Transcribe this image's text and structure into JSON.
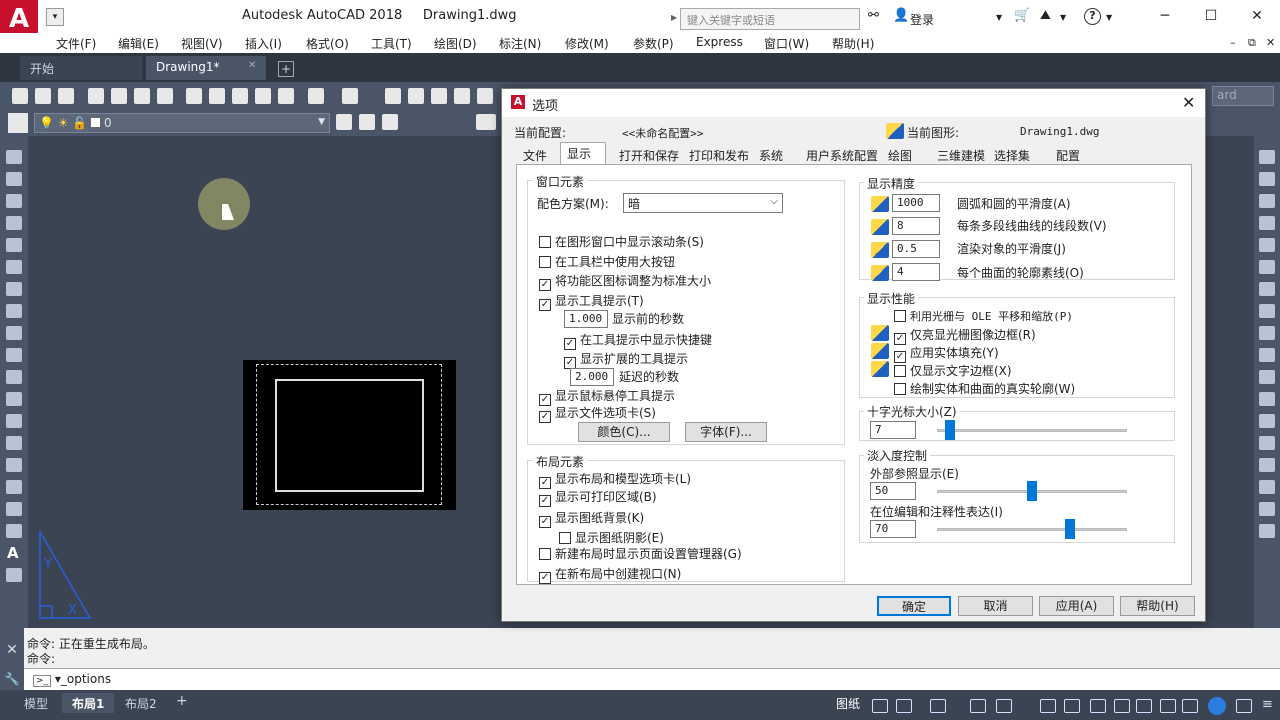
{
  "app": {
    "title": "Autodesk AutoCAD 2018",
    "document": "Drawing1.dwg",
    "logo": "A",
    "search_placeholder": "键入关键字或短语",
    "login": "登录",
    "win_minimize": "─",
    "win_restore": "☐",
    "win_close": "✕"
  },
  "menu": [
    "文件(F)",
    "编辑(E)",
    "视图(V)",
    "插入(I)",
    "格式(O)",
    "工具(T)",
    "绘图(D)",
    "标注(N)",
    "修改(M)",
    "参数(P)",
    "Express",
    "窗口(W)",
    "帮助(H)"
  ],
  "doc_tabs": [
    "开始",
    "Drawing1*"
  ],
  "doc_tab_add": "+",
  "layer_combo": "0",
  "style_combo": "ard",
  "command": {
    "line1": "命令: 正在重生成布局。",
    "line2": "命令:",
    "input": "_options"
  },
  "layout_tabs": [
    "模型",
    "布局1",
    "布局2"
  ],
  "layout_add": "+",
  "status": {
    "paper": "图纸"
  },
  "dialog": {
    "title": "选项",
    "current_profile_label": "当前配置:",
    "current_profile_value": "<<未命名配置>>",
    "current_drawing_label": "当前图形:",
    "current_drawing_value": "Drawing1.dwg",
    "close": "✕",
    "tabs": [
      "文件",
      "显示",
      "打开和保存",
      "打印和发布",
      "系统",
      "用户系统配置",
      "绘图",
      "三维建模",
      "选择集",
      "配置"
    ],
    "window_elements": {
      "title": "窗口元素",
      "scheme_label": "配色方案(M):",
      "scheme_value": "暗",
      "cb_scrollbars": "在图形窗口中显示滚动条(S)",
      "cb_large_buttons": "在工具栏中使用大按钮",
      "cb_ribbon_icons": "将功能区图标调整为标准大小",
      "cb_tooltips": "显示工具提示(T)",
      "tooltip_delay_value": "1.000",
      "tooltip_delay_label": "显示前的秒数",
      "cb_shortcut": "在工具提示中显示快捷键",
      "cb_extended": "显示扩展的工具提示",
      "extended_delay_value": "2.000",
      "extended_delay_label": "延迟的秒数",
      "cb_rollover": "显示鼠标悬停工具提示",
      "cb_file_tabs": "显示文件选项卡(S)",
      "btn_colors": "颜色(C)...",
      "btn_fonts": "字体(F)..."
    },
    "layout_elements": {
      "title": "布局元素",
      "cb_layout_tabs": "显示布局和模型选项卡(L)",
      "cb_printable": "显示可打印区域(B)",
      "cb_paper_bg": "显示图纸背景(K)",
      "cb_paper_shadow": "显示图纸阴影(E)",
      "cb_page_setup": "新建布局时显示页面设置管理器(G)",
      "cb_create_viewport": "在新布局中创建视口(N)"
    },
    "resolution": {
      "title": "显示精度",
      "arc_value": "1000",
      "arc_label": "圆弧和圆的平滑度(A)",
      "polyline_value": "8",
      "polyline_label": "每条多段线曲线的线段数(V)",
      "render_value": "0.5",
      "render_label": "渲染对象的平滑度(J)",
      "contour_value": "4",
      "contour_label": "每个曲面的轮廓素线(O)"
    },
    "performance": {
      "title": "显示性能",
      "cb_raster": "利用光栅与 OLE 平移和缩放(P)",
      "cb_raster_frame": "仅亮显光栅图像边框(R)",
      "cb_fill": "应用实体填充(Y)",
      "cb_text_frame": "仅显示文字边框(X)",
      "cb_silhouettes": "绘制实体和曲面的真实轮廓(W)"
    },
    "crosshair": {
      "title": "十字光标大小(Z)",
      "value": "7",
      "percent": 7
    },
    "fade": {
      "title": "淡入度控制",
      "xref_label": "外部参照显示(E)",
      "xref_value": "50",
      "xref_percent": 50,
      "inplace_label": "在位编辑和注释性表达(I)",
      "inplace_value": "70",
      "inplace_percent": 70
    },
    "buttons": {
      "ok": "确定",
      "cancel": "取消",
      "apply": "应用(A)",
      "help": "帮助(H)"
    }
  },
  "checkbox_states": {
    "scrollbars": false,
    "large_buttons": false,
    "ribbon_icons": true,
    "tooltips": true,
    "shortcut": true,
    "extended": true,
    "rollover": true,
    "file_tabs": true,
    "layout_tabs": true,
    "printable": true,
    "paper_bg": true,
    "paper_shadow": false,
    "page_setup": false,
    "create_viewport": true,
    "raster": false,
    "raster_frame": true,
    "fill": true,
    "text_frame": false,
    "silhouettes": false
  },
  "colors": {
    "accent": "#0078d7",
    "canvas": "#3b4453",
    "brand": "#c8102e"
  }
}
